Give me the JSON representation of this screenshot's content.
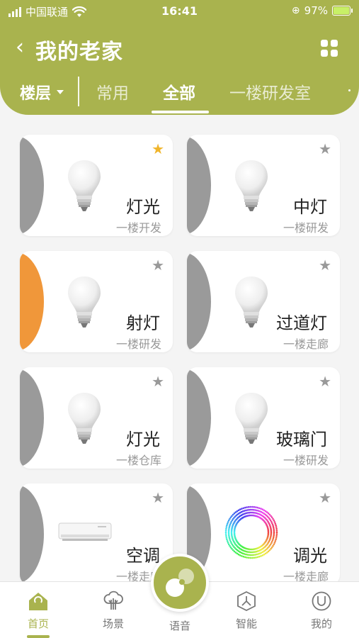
{
  "status": {
    "carrier": "中国联通",
    "time": "16:41",
    "battery": "97%"
  },
  "header": {
    "title": "我的老家",
    "floor_label": "楼层",
    "tabs": [
      {
        "label": "常用",
        "active": false
      },
      {
        "label": "全部",
        "active": true
      },
      {
        "label": "一楼研发室",
        "active": false
      }
    ]
  },
  "devices": [
    {
      "name": "灯光",
      "location": "一楼开发",
      "icon": "bulb-icon",
      "favorite": true,
      "state_color": "#9a9a9a"
    },
    {
      "name": "中灯",
      "location": "一楼研发",
      "icon": "bulb-icon",
      "favorite": false,
      "state_color": "#9a9a9a"
    },
    {
      "name": "射灯",
      "location": "一楼研发",
      "icon": "bulb-icon",
      "favorite": false,
      "state_color": "#f0973a"
    },
    {
      "name": "过道灯",
      "location": "一楼走廊",
      "icon": "bulb-icon",
      "favorite": false,
      "state_color": "#9a9a9a"
    },
    {
      "name": "灯光",
      "location": "一楼仓库",
      "icon": "bulb-icon",
      "favorite": false,
      "state_color": "#9a9a9a"
    },
    {
      "name": "玻璃门",
      "location": "一楼研发",
      "icon": "bulb-icon",
      "favorite": false,
      "state_color": "#9a9a9a"
    },
    {
      "name": "空调",
      "location": "一楼走廊",
      "icon": "air-conditioner-icon",
      "favorite": false,
      "state_color": "#9a9a9a"
    },
    {
      "name": "调光",
      "location": "一楼走廊",
      "icon": "color-ring-icon",
      "favorite": false,
      "state_color": "#9a9a9a"
    }
  ],
  "nav": {
    "home": "首页",
    "scene": "场景",
    "voice": "语音",
    "smart": "智能",
    "mine": "我的"
  },
  "colors": {
    "accent": "#a9b34e",
    "favorite": "#f0b52b",
    "off": "#9a9a9a",
    "on": "#f0973a"
  }
}
